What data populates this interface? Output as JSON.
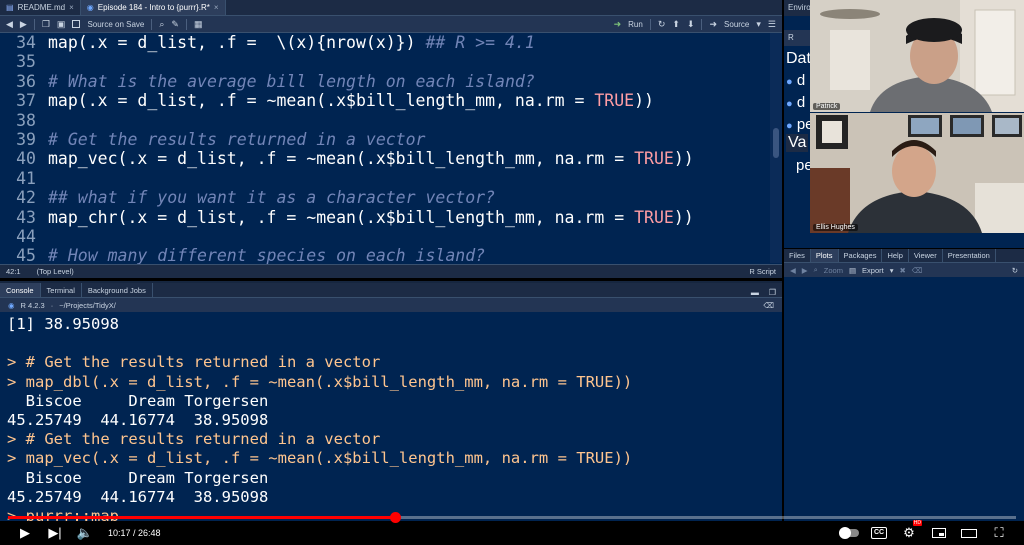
{
  "editor": {
    "tabs": [
      {
        "label": "README.md"
      },
      {
        "label": "Episode 184 - Intro to {purrr}.R*"
      }
    ],
    "toolbar": {
      "source_on_save": "Source on Save",
      "run": "Run",
      "source": "Source"
    },
    "lines": [
      {
        "num": "34",
        "segments": [
          {
            "t": "map(.x = d_list, .f =  \\(x){nrow(x)}) ",
            "c": "plain"
          },
          {
            "t": "## R >= 4.1",
            "c": "cm"
          }
        ]
      },
      {
        "num": "35",
        "segments": []
      },
      {
        "num": "36",
        "segments": [
          {
            "t": "# What is the average bill length on each island?",
            "c": "cm"
          }
        ]
      },
      {
        "num": "37",
        "segments": [
          {
            "t": "map(.x = d_list, .f = ~mean(.x$bill_length_mm, na.rm = ",
            "c": "plain"
          },
          {
            "t": "TRUE",
            "c": "kw"
          },
          {
            "t": "))",
            "c": "plain"
          }
        ]
      },
      {
        "num": "38",
        "segments": []
      },
      {
        "num": "39",
        "segments": [
          {
            "t": "# Get the results returned in a vector",
            "c": "cm"
          }
        ]
      },
      {
        "num": "40",
        "segments": [
          {
            "t": "map_vec(.x = d_list, .f = ~mean(.x$bill_length_mm, na.rm = ",
            "c": "plain"
          },
          {
            "t": "TRUE",
            "c": "kw"
          },
          {
            "t": "))",
            "c": "plain"
          }
        ]
      },
      {
        "num": "41",
        "segments": []
      },
      {
        "num": "42",
        "segments": [
          {
            "t": "## what if you want it as a character vector?",
            "c": "cm"
          }
        ]
      },
      {
        "num": "43",
        "segments": [
          {
            "t": "map_chr(.x = d_list, .f = ~mean(.x$bill_length_mm, na.rm = ",
            "c": "plain"
          },
          {
            "t": "TRUE",
            "c": "kw"
          },
          {
            "t": "))",
            "c": "plain"
          }
        ]
      },
      {
        "num": "44",
        "segments": []
      },
      {
        "num": "45",
        "segments": [
          {
            "t": "# How many different species on each island?",
            "c": "cm"
          }
        ]
      }
    ],
    "status": {
      "position": "42:1",
      "scope": "(Top Level)",
      "filetype": "R Script"
    }
  },
  "console": {
    "tabs": [
      {
        "label": "Console"
      },
      {
        "label": "Terminal"
      },
      {
        "label": "Background Jobs"
      }
    ],
    "version": "R 4.2.3",
    "path": "~/Projects/TidyX/",
    "lines": [
      {
        "t": "[1] 38.95098",
        "c": "out"
      },
      {
        "t": "",
        "c": "out"
      },
      {
        "t": "> # Get the results returned in a vector",
        "c": "in"
      },
      {
        "t": "> map_dbl(.x = d_list, .f = ~mean(.x$bill_length_mm, na.rm = TRUE))",
        "c": "in"
      },
      {
        "t": "  Biscoe     Dream Torgersen ",
        "c": "out"
      },
      {
        "t": "45.25749  44.16774  38.95098 ",
        "c": "out"
      },
      {
        "t": "> # Get the results returned in a vector",
        "c": "in"
      },
      {
        "t": "> map_vec(.x = d_list, .f = ~mean(.x$bill_length_mm, na.rm = TRUE))",
        "c": "in"
      },
      {
        "t": "  Biscoe     Dream Torgersen ",
        "c": "out"
      },
      {
        "t": "45.25749  44.16774  38.95098 ",
        "c": "out"
      },
      {
        "t": "> purrr::map_",
        "c": "in"
      }
    ]
  },
  "environment": {
    "tab": "Enviro",
    "toolbar": "R",
    "data_header": "Dat",
    "rows": [
      "d",
      "d",
      "pe"
    ],
    "values_header": "Va",
    "values_row": "pe"
  },
  "files": {
    "tabs": [
      {
        "label": "Files"
      },
      {
        "label": "Plots"
      },
      {
        "label": "Packages"
      },
      {
        "label": "Help"
      },
      {
        "label": "Viewer"
      },
      {
        "label": "Presentation"
      }
    ],
    "zoom": "Zoom",
    "export": "Export"
  },
  "webcams": [
    {
      "name": "Patrick"
    },
    {
      "name": "Ellis Hughes"
    }
  ],
  "player": {
    "time": "10:17 / 26:48",
    "progress": 0.3837,
    "cc_label": "CC",
    "hd_label": "HD"
  }
}
